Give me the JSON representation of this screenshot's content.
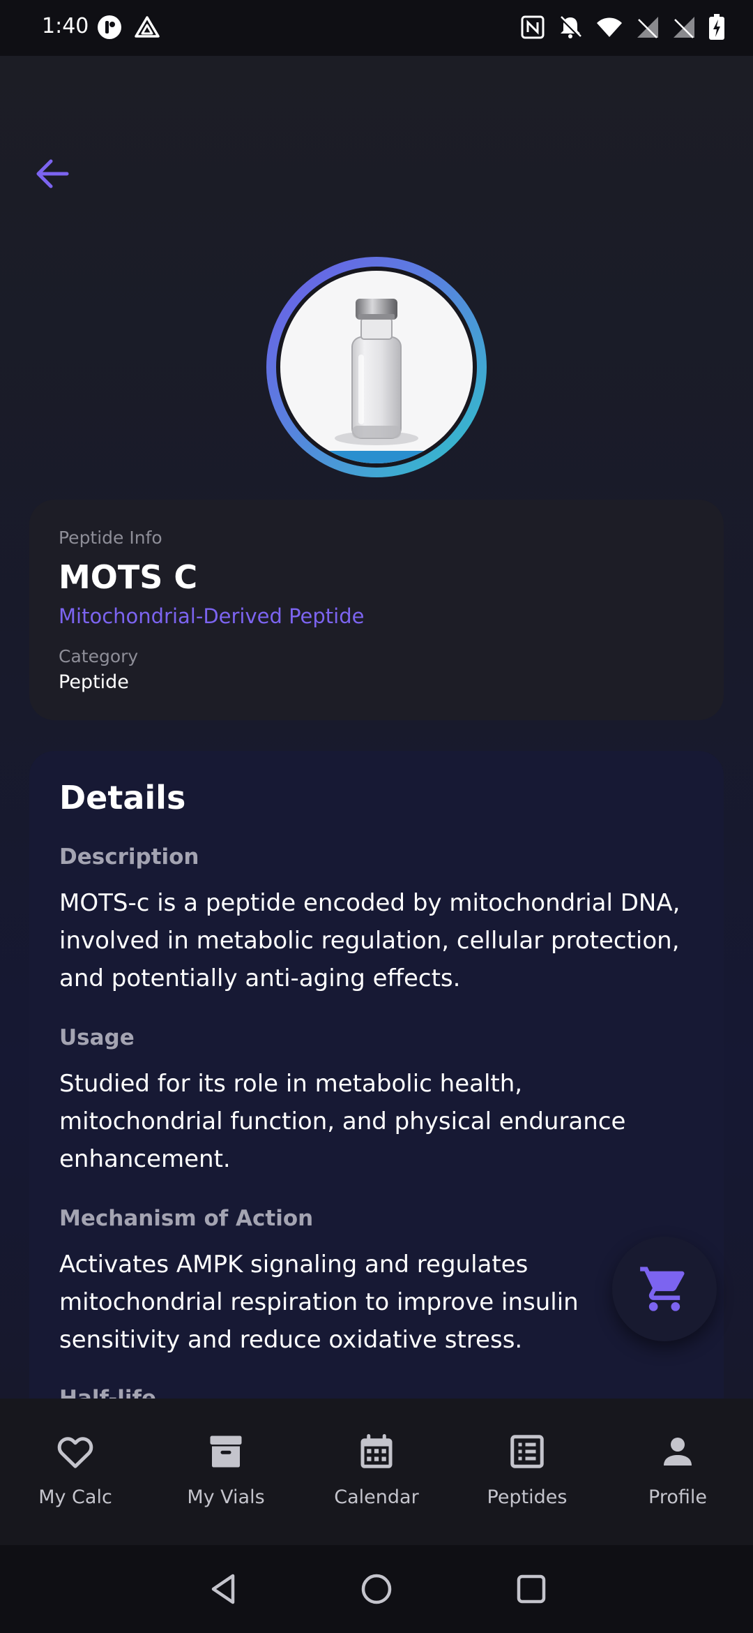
{
  "status_bar": {
    "time": "1:40"
  },
  "peptide_info": {
    "eyebrow": "Peptide Info",
    "name": "MOTS C",
    "subtitle": "Mitochondrial-Derived Peptide",
    "category_label": "Category",
    "category_value": "Peptide"
  },
  "details": {
    "heading": "Details",
    "description_label": "Description",
    "description": "MOTS-c is a peptide encoded by mitochondrial DNA, involved in metabolic regulation, cellular protection, and potentially anti-aging effects.",
    "usage_label": "Usage",
    "usage": "Studied for its role in metabolic health, mitochondrial function, and physical endurance enhancement.",
    "mechanism_label": "Mechanism of Action",
    "mechanism": "Activates AMPK signaling and regulates mitochondrial respiration to improve insulin sensitivity and reduce oxidative stress.",
    "half_life_label": "Half-life"
  },
  "bottom_nav": {
    "items": [
      {
        "label": "My Calc",
        "icon": "heart-icon"
      },
      {
        "label": "My Vials",
        "icon": "archive-box-icon"
      },
      {
        "label": "Calendar",
        "icon": "calendar-icon"
      },
      {
        "label": "Peptides",
        "icon": "list-icon"
      },
      {
        "label": "Profile",
        "icon": "person-icon"
      }
    ]
  },
  "colors": {
    "accent": "#7c64f0",
    "ring_start": "#6c5ce7",
    "ring_end": "#2ec4c9",
    "background": "#1b1c24",
    "card": "#1d1d26",
    "details_card": "#171934"
  }
}
